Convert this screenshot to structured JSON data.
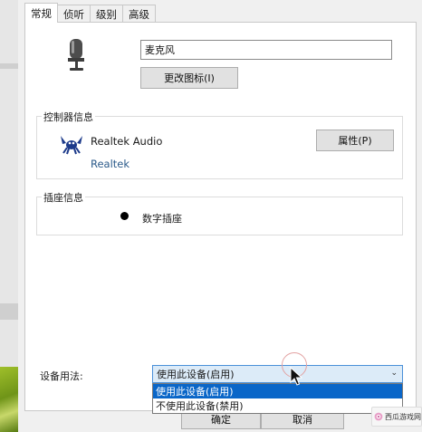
{
  "tabs": [
    "常规",
    "侦听",
    "级别",
    "高级"
  ],
  "device_name": "麦克风",
  "change_icon_button": "更改图标(I)",
  "controller_group": {
    "title": "控制器信息",
    "name": "Realtek Audio",
    "vendor": "Realtek",
    "properties_button": "属性(P)"
  },
  "jack_group": {
    "title": "插座信息",
    "jack": "数字插座"
  },
  "usage": {
    "label": "设备用法:",
    "selected": "使用此设备(启用)",
    "options": [
      "使用此设备(启用)",
      "不使用此设备(禁用)"
    ]
  },
  "footer": {
    "ok": "确定",
    "cancel": "取消"
  },
  "watermark": {
    "text": "西瓜游戏网"
  },
  "colors": {
    "selection": "#0a66c8",
    "select_bg": "#dcebf8"
  }
}
